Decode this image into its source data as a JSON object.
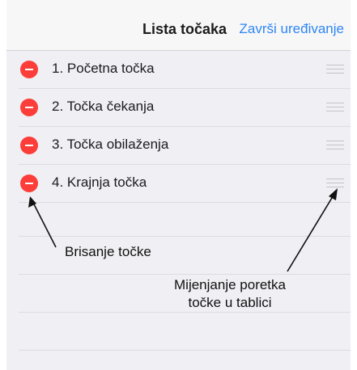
{
  "navbar": {
    "title": "Lista točaka",
    "done_label": "Završi uređivanje"
  },
  "rows": [
    {
      "label": "1. Početna točka"
    },
    {
      "label": "2. Točka čekanja"
    },
    {
      "label": "3. Točka obilaženja"
    },
    {
      "label": "4. Krajnja točka"
    }
  ],
  "annotations": {
    "delete": "Brisanje točke",
    "reorder_line1": "Mijenjanje poretka",
    "reorder_line2": "točke u tablici"
  },
  "colors": {
    "accent": "#2f86f6",
    "delete": "#fc3d39",
    "background": "#efeff4"
  }
}
